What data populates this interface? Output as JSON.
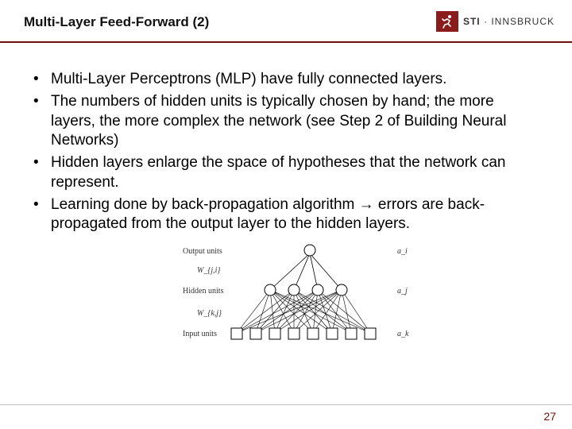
{
  "header": {
    "title": "Multi-Layer Feed-Forward (2)",
    "logo": {
      "brand_bold": "STI",
      "brand_dot": " · ",
      "brand_rest": "INNSBRUCK",
      "icon": "runner-icon"
    }
  },
  "bullets": [
    "Multi-Layer Perceptrons (MLP) have fully connected layers.",
    "The numbers of hidden units is typically chosen by hand; the more layers, the more complex the network (see Step 2 of Building Neural Networks)",
    "Hidden layers enlarge the space of hypotheses that the network can represent.",
    "Learning done by back-propagation algorithm → errors are back-propagated from the output layer to the hidden layers."
  ],
  "diagram": {
    "labels": {
      "output": "Output units",
      "hidden": "Hidden units",
      "input": "Input units",
      "w_ji": "W_{j,i}",
      "w_kj": "W_{k,j}",
      "a_i": "a_i",
      "a_j": "a_j",
      "a_k": "a_k"
    },
    "counts": {
      "output": 1,
      "hidden": 4,
      "input": 8
    }
  },
  "page_number": "27"
}
